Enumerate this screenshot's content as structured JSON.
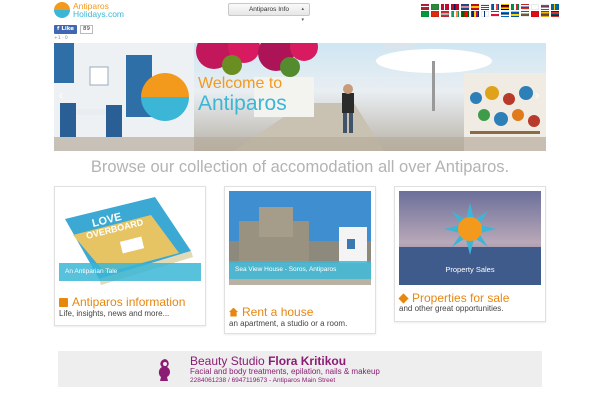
{
  "header": {
    "logo_line1": "Antiparos",
    "logo_line2": "Holidays.com",
    "info_button": "Antiparos Info",
    "language_flags": [
      "us",
      "ar",
      "dk",
      "nl",
      "es",
      "fr",
      "de",
      "gr",
      "it",
      "ru",
      "se",
      "fi",
      "no",
      "il",
      "rs",
      "bg",
      "it2"
    ],
    "colors": {
      "orange": "#f39a1d",
      "blue": "#3bb6d6"
    }
  },
  "social": {
    "fb_like_label": "Like",
    "fb_like_count": "89",
    "gplus_text": "+1 · 0"
  },
  "hero": {
    "title_line1": "Welcome to",
    "title_line2": "Antiparos",
    "prev_arrow": "‹",
    "next_arrow": "›"
  },
  "tagline": "Browse our collection of accomodation all over Antiparos.",
  "cards": [
    {
      "caption": "An Antiparian Tale",
      "book_text": "LOVE OVERBOARD",
      "title": "Antiparos information",
      "subtitle": "Life, insights, news and more...",
      "icon": "book-icon"
    },
    {
      "caption": "Sea View House - Soros, Antiparos",
      "title": "Rent a house",
      "subtitle": "an apartment, a studio or a room.",
      "icon": "home-icon"
    },
    {
      "caption": "Property Sales",
      "title": "Properties for sale",
      "subtitle": "and other great opportunities.",
      "icon": "diamond-icon"
    }
  ],
  "banner": {
    "name_prefix": "Beauty Studio ",
    "name_bold": "Flora Kritikou",
    "services": "Facial and body treatments, epilation, nails & makeup",
    "contact": "2284061238 / 6947119673 - Antiparos Main Street",
    "color": "#8a1d73"
  }
}
